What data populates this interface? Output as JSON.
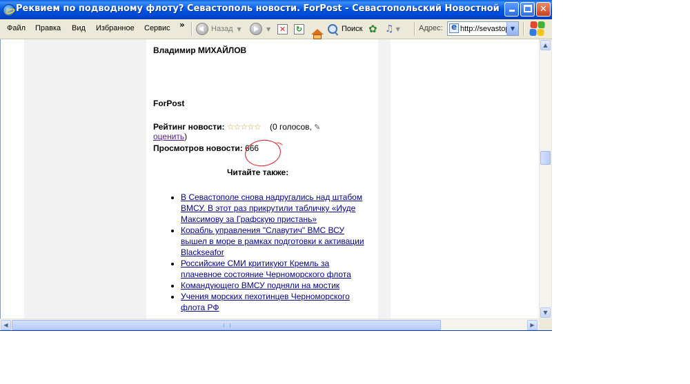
{
  "window": {
    "title": "Реквием по подводному флоту? Севастополь новости. ForPost - Севастопольский Новостной Портал - Windo..."
  },
  "menu": {
    "items": [
      "Файл",
      "Правка",
      "Вид",
      "Избранное",
      "Сервис"
    ],
    "overflow": "»"
  },
  "toolbar": {
    "back_label": "Назад",
    "search_label": "Поиск",
    "address_label": "Адрес:",
    "address_value": "http://sevastopol"
  },
  "article": {
    "author": "Владимир МИХАЙЛОВ",
    "source": "ForPost",
    "rating_label": "Рейтинг новости:",
    "stars": "☆☆☆☆☆",
    "votes_text": "(0 голосов,",
    "rate_link": "оценить",
    "rate_close": ")",
    "views_label": "Просмотров новости:",
    "views_count": "666",
    "read_also": "Читайте также:",
    "related": [
      "В Севастополе снова надругались над штабом ВМСУ. В этот раз прикрутили табличку «Иуде Максимову за Графскую пристань»",
      "Корабль управления \"Славутич\" ВМС ВСУ вышел в море в рамках подготовки к активации Blackseafor",
      "Российские СМИ критикуют Кремль за плачевное состояние Черноморского флота",
      "Командующего ВМСУ подняли на мостик",
      "Учения морских пехотинцев Черноморского флота РФ"
    ]
  },
  "colors": {
    "titlebar": "#0055e5",
    "chrome": "#ece9d8",
    "link": "#00008b",
    "visited_link": "#551a8b",
    "annotation": "#e0141a"
  }
}
